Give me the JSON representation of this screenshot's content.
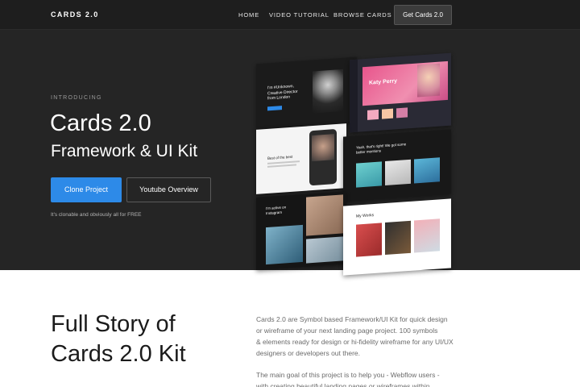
{
  "nav": {
    "brand": "CARDS 2.0",
    "links": [
      "HOME",
      "VIDEO TUTORIAL",
      "BROWSE CARDS"
    ],
    "cta": "Get Cards 2.0"
  },
  "hero": {
    "kicker": "INTRODUCING",
    "title": "Cards 2.0",
    "subtitle": "Framework & UI Kit",
    "primary_button": "Clone Project",
    "secondary_button": "Youtube Overview",
    "fine_print": "It's clonable and obviously all for FREE"
  },
  "collage": {
    "card1_text": "I'm #Unknown, Creative Director from London",
    "card2_text": "Katy Perry",
    "card3_text": "Best of the best",
    "card4_text": "Yeah, that's right! We got some better mentions",
    "card5_text": "I'm active on Instagram",
    "card6_text": "My Works"
  },
  "story": {
    "title_line1": "Full Story of",
    "title_line2": "Cards 2.0 Kit",
    "paragraph1": [
      "Cards 2.0 are Symbol based Framework/UI Kit for quick design",
      "or wireframe of your next landing page project. 100 symbols",
      "& elements ready for design or hi-fidelity wireframe for any UI/UX",
      "designers or developers out there."
    ],
    "paragraph2": [
      "The main goal of this project is to help you - Webflow users -",
      "with creating beautiful landing pages or wireframes within"
    ]
  }
}
